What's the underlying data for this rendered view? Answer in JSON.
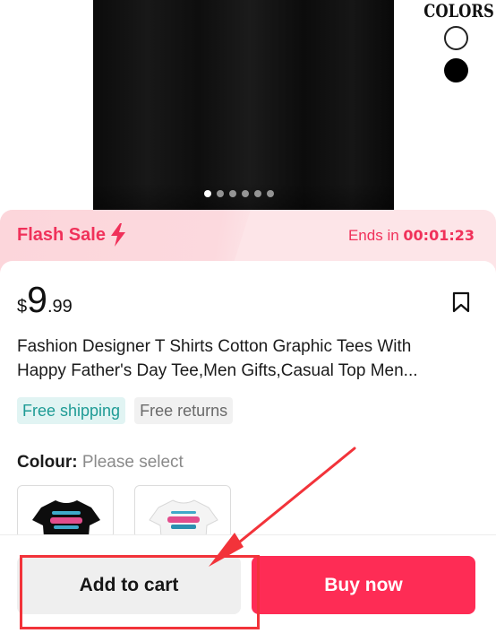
{
  "hero": {
    "colors_label": "COLORS",
    "swatches": [
      "white",
      "black"
    ],
    "carousel": {
      "total": 6,
      "active": 1
    }
  },
  "flash_sale": {
    "label": "Flash Sale",
    "icon": "lightning-bolt-icon",
    "ends_label": "Ends in",
    "timer": "00:01:23"
  },
  "product": {
    "price_currency": "$",
    "price_integer": "9",
    "price_decimal": ".99",
    "title_line1": "Fashion Designer T Shirts Cotton Graphic Tees With",
    "title_line2": "Happy Father's Day Tee,Men Gifts,Casual Top Men...",
    "tags": [
      "Free shipping",
      "Free returns"
    ],
    "colour_label": "Colour:",
    "colour_hint": "Please select",
    "colour_options": [
      "black",
      "white"
    ]
  },
  "actions": {
    "add_to_cart": "Add to cart",
    "buy_now": "Buy now"
  },
  "colors": {
    "accent": "#fe2c55",
    "flash_text": "#f0315a",
    "annotation": "#f2333a"
  }
}
